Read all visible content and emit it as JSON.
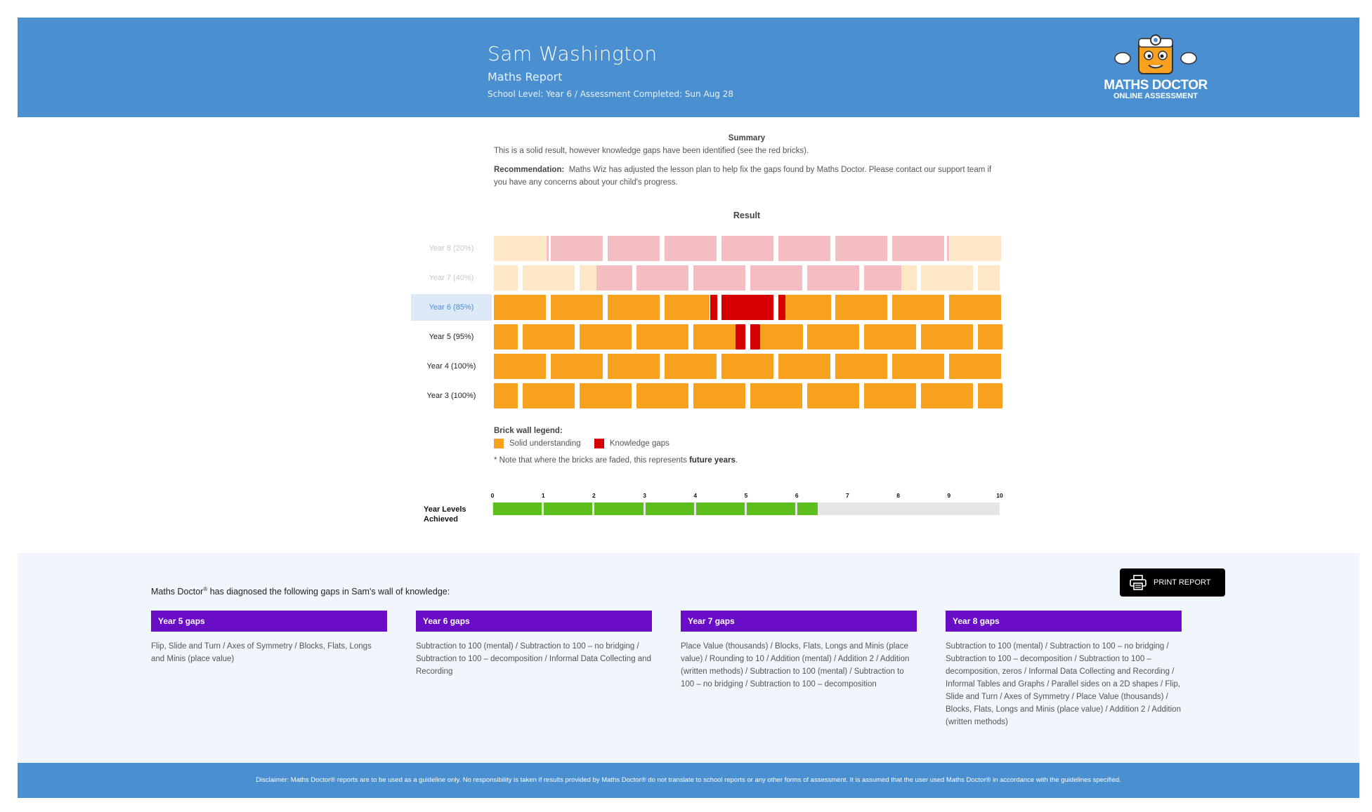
{
  "header": {
    "student_name": "Sam Washington",
    "report_title": "Maths Report",
    "meta": "School Level: Year 6  / Assessment Completed: Sun Aug 28",
    "logo_text": "MATHS DOCTOR",
    "logo_sub": "ONLINE ASSESSMENT",
    "logo_icon": "doctor-mascot-icon"
  },
  "summary": {
    "title": "Summary",
    "text": "This is a solid result, however knowledge gaps have been identified (see the red bricks).",
    "recommendation_label": "Recommendation:",
    "recommendation_text": "Maths Wiz has adjusted the lesson plan to help fix the gaps found by Maths Doctor. Please contact our support team if you have any concerns about your child's progress."
  },
  "result": {
    "title": "Result",
    "rows": [
      {
        "label": "Year 8 (20%)",
        "state": "future",
        "percent": 20
      },
      {
        "label": "Year 7 (40%)",
        "state": "future",
        "percent": 40
      },
      {
        "label": "Year 6 (85%)",
        "state": "selected",
        "percent": 85
      },
      {
        "label": "Year 5 (95%)",
        "state": "normal",
        "percent": 95
      },
      {
        "label": "Year 4 (100%)",
        "state": "normal",
        "percent": 100
      },
      {
        "label": "Year 3 (100%)",
        "state": "normal",
        "percent": 100
      }
    ]
  },
  "legend": {
    "title": "Brick wall legend:",
    "solid_label": "Solid understanding",
    "gaps_label": "Knowledge gaps",
    "note_prefix": "* Note that where the bricks are faded, this represents ",
    "note_bold": "future years",
    "note_suffix": ".",
    "colors": {
      "solid": "#f8a11f",
      "gap": "#d60000",
      "faded_solid": "#fde7c7",
      "faded_gap": "#f4bdc1"
    }
  },
  "year_levels": {
    "label_line1": "Year Levels",
    "label_line2": "Achieved",
    "ticks": [
      "0",
      "1",
      "2",
      "3",
      "4",
      "5",
      "6",
      "7",
      "8",
      "9",
      "10"
    ],
    "achieved": 6.4,
    "max": 10,
    "bar_color": "#5cbf1e"
  },
  "gaps": {
    "intro_prefix": "Maths Doctor",
    "intro_sup": "®",
    "intro_suffix": " has diagnosed the following gaps in Sam's wall of knowledge:",
    "print_label": "PRINT REPORT",
    "columns": [
      {
        "title": "Year 5 gaps",
        "text": "Flip, Slide and Turn / Axes of Symmetry / Blocks, Flats, Longs and Minis (place value)"
      },
      {
        "title": "Year 6 gaps",
        "text": "Subtraction to 100 (mental) / Subtraction to 100 – no bridging / Subtraction to 100 – decomposition / Informal Data Collecting and Recording"
      },
      {
        "title": "Year 7 gaps",
        "text": "Place Value (thousands) / Blocks, Flats, Longs and Minis (place value) / Rounding to 10 / Addition (mental) / Addition 2 / Addition (written methods) / Subtraction to 100 (mental) / Subtraction to 100 – no bridging / Subtraction to 100 – decomposition"
      },
      {
        "title": "Year 8 gaps",
        "text": "Subtraction to 100 (mental) / Subtraction to 100 – no bridging / Subtraction to 100 – decomposition / Subtraction to 100 – decomposition, zeros / Informal Data Collecting and Recording / Informal Tables and Graphs / Parallel sides on a 2D shapes / Flip, Slide and Turn / Axes of Symmetry / Place Value (thousands) / Blocks, Flats, Longs and Minis (place value) / Addition 2 / Addition (written methods)"
      }
    ]
  },
  "footer": {
    "disclaimer": "Disclaimer: Maths Doctor® reports are to be used as a guideline only. No responsibility is taken if results provided by Maths Doctor® do not translate to school reports or any other forms of assessment. It is assumed that the user used Maths Doctor® in accordance with the guidelines specified."
  }
}
